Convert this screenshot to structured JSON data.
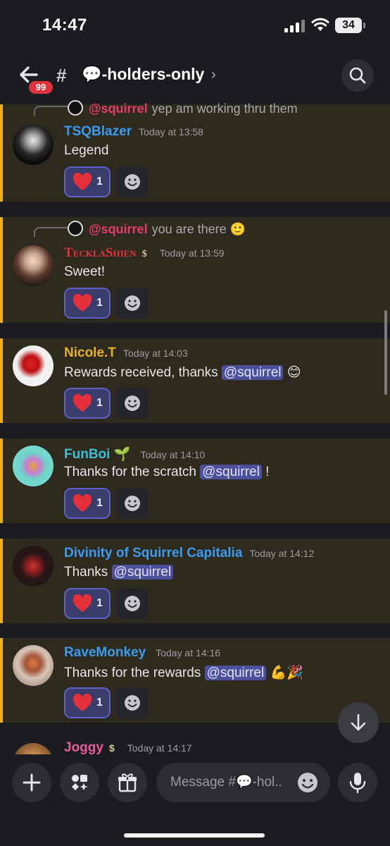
{
  "status": {
    "time": "14:47",
    "battery": "34"
  },
  "header": {
    "badge": "99",
    "channel": "💬-holders-only",
    "chevron": "›"
  },
  "messages": [
    {
      "reply": {
        "user": "@squirrel",
        "text": "yep am working thru them"
      },
      "author": "TSQBlazer",
      "author_color": "#3b9cf0",
      "time": "Today at 13:58",
      "text": "Legend",
      "reaction_count": "1"
    },
    {
      "reply": {
        "user": "@squirrel",
        "text": "you are there 🙂"
      },
      "author": "TecklaShien",
      "author_color": "#e0333d",
      "time": "Today at 13:59",
      "text": "Sweet!",
      "reaction_count": "1"
    },
    {
      "author": "Nicole.T",
      "author_color": "#e8b21e",
      "time": "Today at 14:03",
      "text": "Rewards received, thanks ",
      "mention": "@squirrel",
      "suffix": " 😊",
      "reaction_count": "1"
    },
    {
      "author": "FunBoi 🌱",
      "author_color": "#3fbfd6",
      "time": "Today at 14:10",
      "text": "Thanks for the scratch ",
      "mention": "@squirrel",
      "suffix": " !",
      "reaction_count": "1"
    },
    {
      "author": "Divinity of Squirrel Capitalia",
      "author_color": "#3b9cf0",
      "time": "Today at 14:12",
      "text": "Thanks ",
      "mention": "@squirrel",
      "suffix": "",
      "reaction_count": "1"
    },
    {
      "author": "RaveMonkey",
      "author_color": "#3b9cf0",
      "time": "Today at 14:16",
      "text": "Thanks for the rewards ",
      "mention": "@squirrel",
      "suffix": " 💪🎉",
      "reaction_count": "1"
    },
    {
      "author": "Joggy",
      "author_color": "#e85a9a",
      "time": "Today at 14:17"
    }
  ],
  "composer": {
    "placeholder": "Message #💬-hol.."
  },
  "icons": [
    "back-arrow-icon",
    "hash-icon",
    "search-icon",
    "heart-icon",
    "add-reaction-icon",
    "plus-icon",
    "apps-icon",
    "gift-icon",
    "emoji-icon",
    "mic-icon",
    "arrow-down-icon",
    "wifi-icon",
    "signal-icon"
  ]
}
